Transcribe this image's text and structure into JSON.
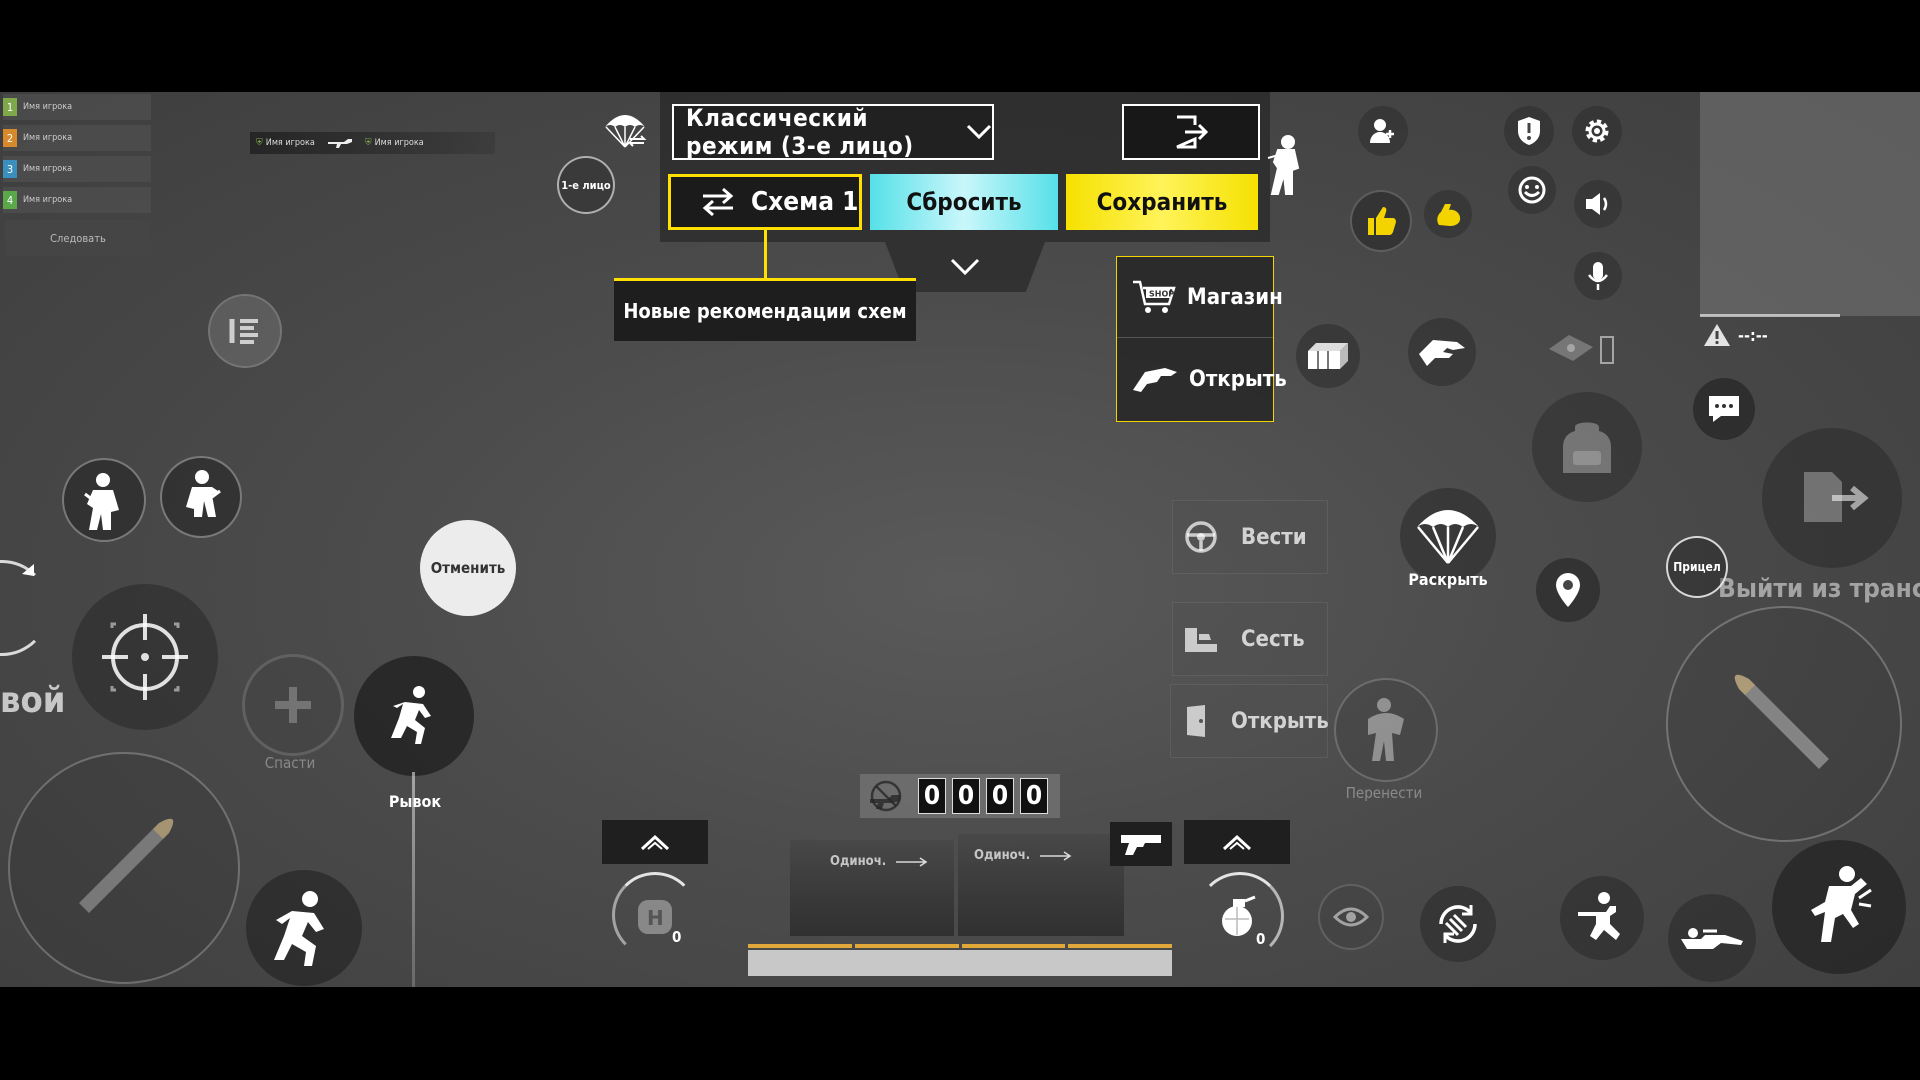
{
  "team": {
    "players": [
      {
        "num": "1",
        "name": "Имя игрока",
        "color": "#7fa84a"
      },
      {
        "num": "2",
        "name": "Имя игрока",
        "color": "#d68a2c"
      },
      {
        "num": "3",
        "name": "Имя игрока",
        "color": "#3a8fbf"
      },
      {
        "num": "4",
        "name": "Имя игрока",
        "color": "#5aa84a"
      }
    ],
    "follow_label": "Следовать"
  },
  "killfeed": {
    "left_name": "Имя игрока",
    "right_name": "Имя игрока"
  },
  "view_toggle": {
    "label": "1-е лицо"
  },
  "menu": {
    "mode_label": "Классический режим (3-е лицо)",
    "scheme_label": "Схема 1",
    "reset_label": "Сбросить",
    "save_label": "Сохранить",
    "tooltip": "Новые рекомендации схем",
    "shop_label": "Магазин",
    "open_label": "Открыть",
    "accent_yellow": "#ffe000",
    "accent_cyan": "#56e0e8"
  },
  "vehicle": {
    "drive_label": "Вести",
    "sit_label": "Сесть",
    "open_door_label": "Открыть",
    "carry_label": "Перенести",
    "parachute_label": "Раскрыть",
    "exit_label": "Выйти из транспорта",
    "aim_label": "Прицел"
  },
  "left_controls": {
    "cancel_label": "Отменить",
    "rescue_label": "Спасти",
    "dash_label": "Рывок",
    "cut_text": "вой"
  },
  "ammo": {
    "digits": [
      "0",
      "0",
      "0",
      "0"
    ]
  },
  "fire_modes": {
    "left": "Одиноч.",
    "right": "Одиноч."
  },
  "throwables": {
    "left_count": "0",
    "right_count": "0"
  },
  "minimap": {
    "warning": "--:--"
  }
}
